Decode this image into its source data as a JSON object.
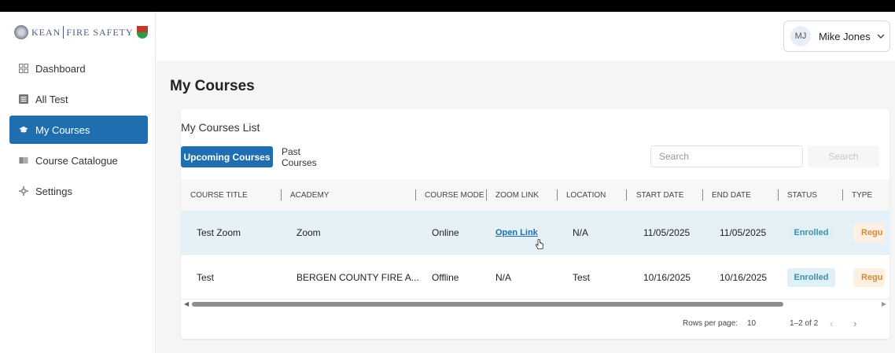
{
  "brand": {
    "university": "KEAN",
    "program": "FIRE SAFETY"
  },
  "sidebar": {
    "items": [
      {
        "label": "Dashboard",
        "icon": "dashboard-icon",
        "active": false
      },
      {
        "label": "All Test",
        "icon": "list-icon",
        "active": false
      },
      {
        "label": "My Courses",
        "icon": "graduation-cap-icon",
        "active": true
      },
      {
        "label": "Course Catalogue",
        "icon": "book-icon",
        "active": false
      },
      {
        "label": "Settings",
        "icon": "gear-icon",
        "active": false
      }
    ]
  },
  "user": {
    "initials": "MJ",
    "name": "Mike Jones"
  },
  "page": {
    "title": "My Courses"
  },
  "card": {
    "title": "My Courses List",
    "tabs": [
      {
        "label": "Upcoming Courses",
        "active": true
      },
      {
        "label": "Past Courses",
        "active": false
      }
    ],
    "search": {
      "placeholder": "Search",
      "button_label": "Search"
    }
  },
  "table": {
    "columns": [
      "COURSE TITLE",
      "ACADEMY",
      "COURSE MODE",
      "ZOOM LINK",
      "LOCATION",
      "START DATE",
      "END DATE",
      "STATUS",
      "TYPE"
    ],
    "rows": [
      {
        "title": "Test Zoom",
        "academy": "Zoom",
        "mode": "Online",
        "zoom": "Open Link",
        "location": "N/A",
        "start": "11/05/2025",
        "end": "11/05/2025",
        "status": "Enrolled",
        "type": "Regu"
      },
      {
        "title": "Test",
        "academy": "BERGEN COUNTY FIRE A...",
        "mode": "Offline",
        "zoom": "N/A",
        "location": "Test",
        "start": "10/16/2025",
        "end": "10/16/2025",
        "status": "Enrolled",
        "type": "Regu"
      }
    ],
    "footer": {
      "rows_per_page_label": "Rows per page:",
      "rows_per_page_value": "10",
      "range": "1–2 of 2"
    }
  },
  "colors": {
    "accent": "#1f6fb0",
    "status_bg": "#e0f1f5",
    "type_bg": "#fdefe2"
  }
}
